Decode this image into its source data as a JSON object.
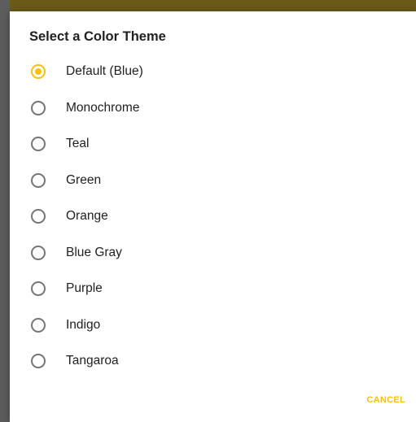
{
  "dialog": {
    "title": "Select a Color Theme",
    "options": [
      {
        "label": "Default (Blue)",
        "selected": true
      },
      {
        "label": "Monochrome",
        "selected": false
      },
      {
        "label": "Teal",
        "selected": false
      },
      {
        "label": "Green",
        "selected": false
      },
      {
        "label": "Orange",
        "selected": false
      },
      {
        "label": "Blue Gray",
        "selected": false
      },
      {
        "label": "Purple",
        "selected": false
      },
      {
        "label": "Indigo",
        "selected": false
      },
      {
        "label": "Tangaroa",
        "selected": false
      }
    ],
    "cancel_label": "CANCEL"
  },
  "colors": {
    "accent": "#f4c20d",
    "radio_unchecked": "#757575",
    "text": "#212121",
    "dialog_background": "#ffffff",
    "scrim": "#7a7a7a",
    "top_band": "#6b5a1a"
  },
  "icons": {
    "selected": "radio-checked-icon",
    "unselected": "radio-unchecked-icon"
  }
}
